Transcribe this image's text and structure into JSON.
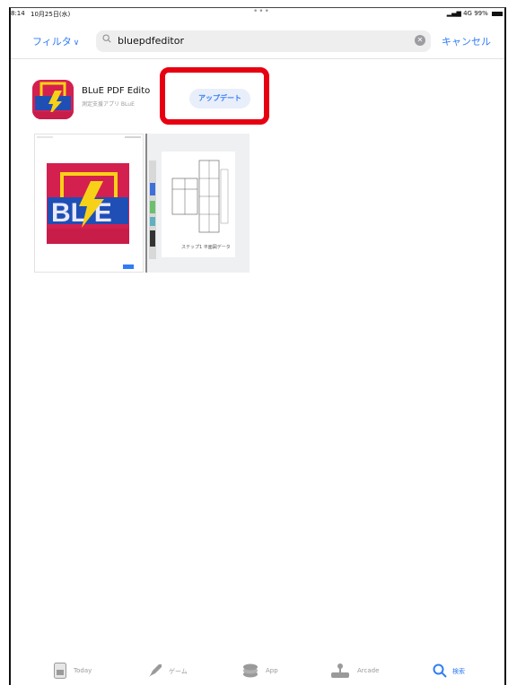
{
  "status_bar": {
    "time": "8:14",
    "date": "10月25日(水)",
    "signal": "4G",
    "battery": "99%"
  },
  "search": {
    "filter_label": "フィルタ",
    "query": "bluepdfeditor",
    "cancel_label": "キャンセル"
  },
  "result": {
    "app_name": "BLuE PDF Edito",
    "app_subtitle": "測定支援アプリ BLuE",
    "update_label": "アップデート",
    "screenshot_2_caption": "ステップ1 平面図データ"
  },
  "tab_bar": {
    "items": [
      {
        "label": "Today",
        "icon": "today-icon",
        "active": false
      },
      {
        "label": "ゲーム",
        "icon": "rocket-icon",
        "active": false
      },
      {
        "label": "App",
        "icon": "apps-stack-icon",
        "active": false
      },
      {
        "label": "Arcade",
        "icon": "joystick-icon",
        "active": false
      },
      {
        "label": "検索",
        "icon": "search-icon",
        "active": true
      }
    ]
  },
  "colors": {
    "accent": "#2f7cf6",
    "highlight": "#e60012",
    "icon_red": "#d4204f",
    "icon_blue": "#1f4fb5",
    "icon_yellow": "#f7d117",
    "inactive": "#9a9a9a"
  }
}
